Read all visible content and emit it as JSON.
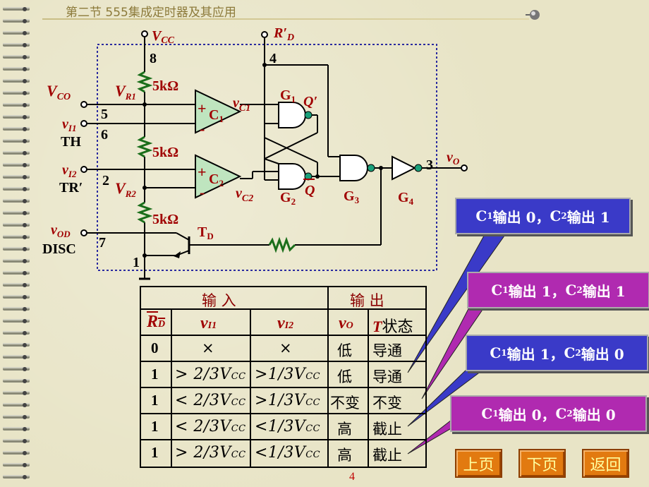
{
  "title": "第二节  555集成定时器及其应用",
  "circuit": {
    "vcc": "V",
    "vcc_sub": "CC",
    "rd": "R′",
    "rd_sub": "D",
    "pin8": "8",
    "pin4": "4",
    "pin5": "5",
    "pin6": "6",
    "pin2": "2",
    "pin7": "7",
    "pin1": "1",
    "pin3": "3",
    "vco": "V",
    "vco_sub": "CO",
    "vi1": "v",
    "vi1_sub": "I1",
    "th": "TH",
    "vi2": "v",
    "vi2_sub": "I2",
    "tr": "TR′",
    "vod": "v",
    "vod_sub": "OD",
    "disc": "DISC",
    "vr1": "V",
    "vr1_sub": "R1",
    "vr2": "V",
    "vr2_sub": "R2",
    "r1": "5kΩ",
    "r2": "5kΩ",
    "r3": "5kΩ",
    "c1": "C",
    "c1_sub": "1",
    "c2": "C",
    "c2_sub": "2",
    "plus": "+",
    "minus": "-",
    "vc1": "v",
    "vc1_sub": "C1",
    "vc2": "v",
    "vc2_sub": "C2",
    "g1": "G",
    "g1_sub": "1",
    "g2": "G",
    "g2_sub": "2",
    "g3": "G",
    "g3_sub": "3",
    "g4": "G",
    "g4_sub": "4",
    "qp": "Q′",
    "q": "Q",
    "td": "T",
    "td_sub": "D",
    "vo": "v",
    "vo_sub": "O"
  },
  "table": {
    "head_input": "输    入",
    "head_output": "输    出",
    "col_rd": "R",
    "col_rd_sub": "D",
    "col_vi1": "v",
    "col_vi1_sub": "I1",
    "col_vi2": "v",
    "col_vi2_sub": "I2",
    "col_vo": "v",
    "col_vo_sub": "O",
    "col_t": "T",
    "col_t_suffix": "状态",
    "rows": [
      {
        "rd": "0",
        "vi1": "×",
        "vi2": "×",
        "vo": "低",
        "t": "导通"
      },
      {
        "rd": "1",
        "vi1": "> 2/3V",
        "vi1_sub": "CC",
        "vi2": ">1/3V",
        "vi2_sub": "CC",
        "vo": "低",
        "t": "导通"
      },
      {
        "rd": "1",
        "vi1": "< 2/3V",
        "vi1_sub": "CC",
        "vi2": ">1/3V",
        "vi2_sub": "CC",
        "vo": "不变",
        "t": "不变"
      },
      {
        "rd": "1",
        "vi1": "< 2/3V",
        "vi1_sub": "CC",
        "vi2": "<1/3V",
        "vi2_sub": "CC",
        "vo": "高",
        "t": "截止"
      },
      {
        "rd": "1",
        "vi1": "> 2/3V",
        "vi1_sub": "CC",
        "vi2": "<1/3V",
        "vi2_sub": "CC",
        "vo": "高",
        "t": "截止"
      }
    ]
  },
  "callouts": [
    {
      "a": "C",
      "a_sub": "1",
      "mid": "输出 0，",
      "b": "C",
      "b_sub": "2",
      "end": "输出 1",
      "color": "#3a3ac8"
    },
    {
      "a": "C",
      "a_sub": "1",
      "mid": "输出 1，",
      "b": "C",
      "b_sub": "2",
      "end": "输出 1",
      "color": "#b02ab0"
    },
    {
      "a": "C",
      "a_sub": "1",
      "mid": "输出 1，",
      "b": "C",
      "b_sub": "2",
      "end": "输出 0",
      "color": "#3a3ac8"
    },
    {
      "a": "C",
      "a_sub": "1",
      "mid": "输出 0，",
      "b": "C",
      "b_sub": "2",
      "end": "输出 0",
      "color": "#b02ab0"
    }
  ],
  "nav": {
    "prev": "上页",
    "next": "下页",
    "back": "返回"
  },
  "page_number": "4"
}
